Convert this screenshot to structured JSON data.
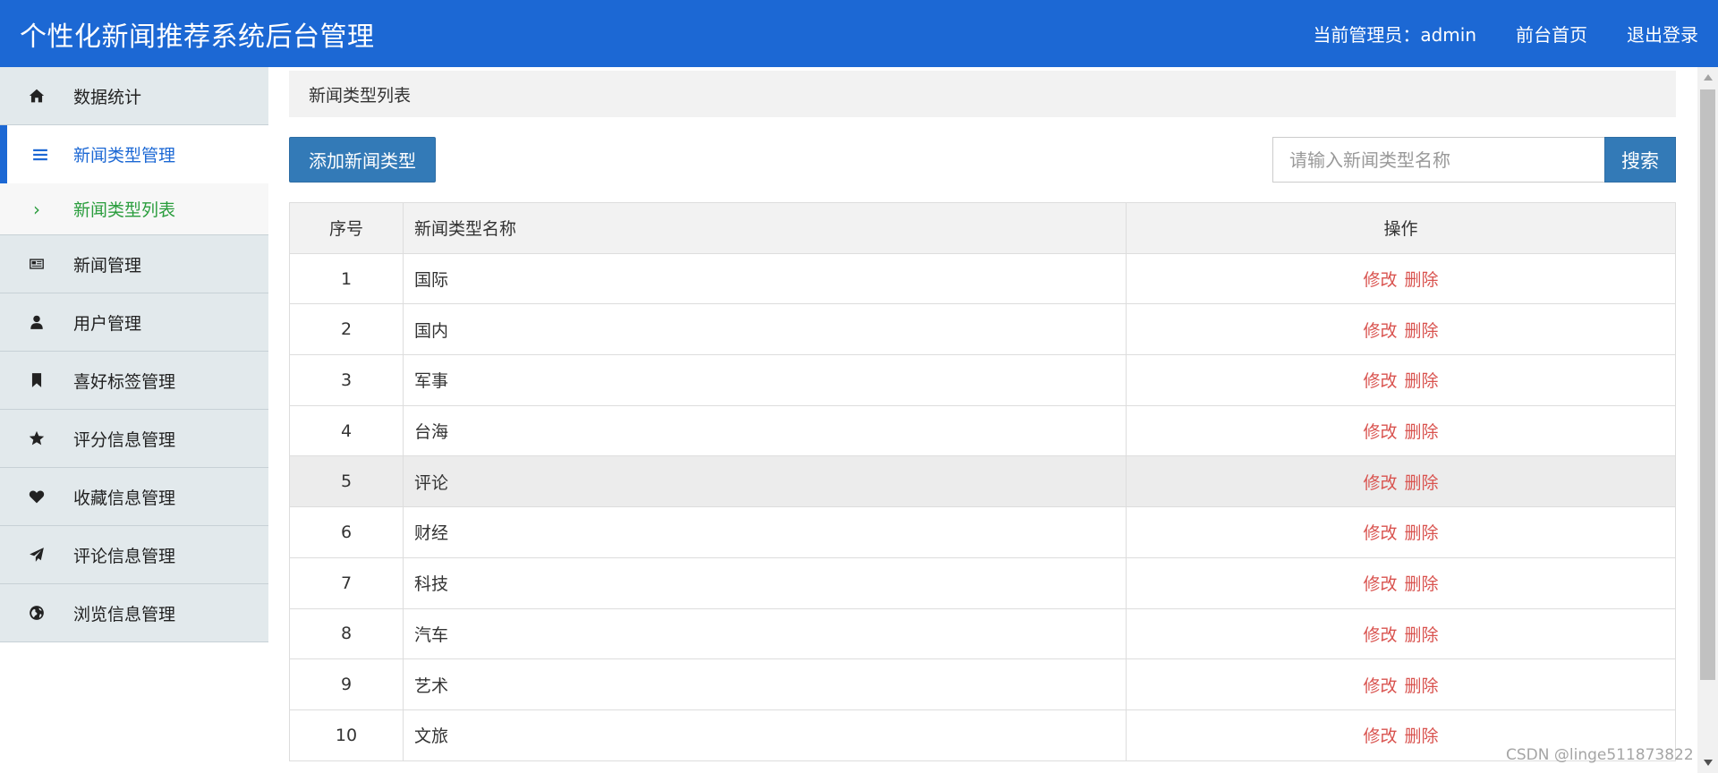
{
  "header": {
    "title": "个性化新闻推荐系统后台管理",
    "admin_label": "当前管理员：admin",
    "home_link": "前台首页",
    "logout_link": "退出登录",
    "bg_color": "#1c68d4"
  },
  "sidebar": {
    "items": [
      {
        "label": "数据统计",
        "icon": "home-icon"
      },
      {
        "label": "新闻类型管理",
        "icon": "list-icon",
        "active": true
      },
      {
        "label": "新闻管理",
        "icon": "newspaper-icon"
      },
      {
        "label": "用户管理",
        "icon": "user-icon"
      },
      {
        "label": "喜好标签管理",
        "icon": "bookmark-icon"
      },
      {
        "label": "评分信息管理",
        "icon": "star-icon"
      },
      {
        "label": "收藏信息管理",
        "icon": "heart-icon"
      },
      {
        "label": "评论信息管理",
        "icon": "send-icon"
      },
      {
        "label": "浏览信息管理",
        "icon": "globe-icon"
      }
    ],
    "sub_item": {
      "label": "新闻类型列表",
      "icon": "chevron-right-icon"
    }
  },
  "main": {
    "breadcrumb": "新闻类型列表",
    "add_button": "添加新闻类型",
    "search": {
      "placeholder": "请输入新闻类型名称",
      "value": "",
      "button": "搜索"
    },
    "table": {
      "headers": [
        "序号",
        "新闻类型名称",
        "操作"
      ],
      "rows": [
        {
          "no": "1",
          "name": "国际"
        },
        {
          "no": "2",
          "name": "国内"
        },
        {
          "no": "3",
          "name": "军事"
        },
        {
          "no": "4",
          "name": "台海"
        },
        {
          "no": "5",
          "name": "评论"
        },
        {
          "no": "6",
          "name": "财经"
        },
        {
          "no": "7",
          "name": "科技"
        },
        {
          "no": "8",
          "name": "汽车"
        },
        {
          "no": "9",
          "name": "艺术"
        },
        {
          "no": "10",
          "name": "文旅"
        }
      ],
      "edit_label": "修改",
      "delete_label": "删除"
    }
  },
  "watermark": "CSDN @linge511873822"
}
